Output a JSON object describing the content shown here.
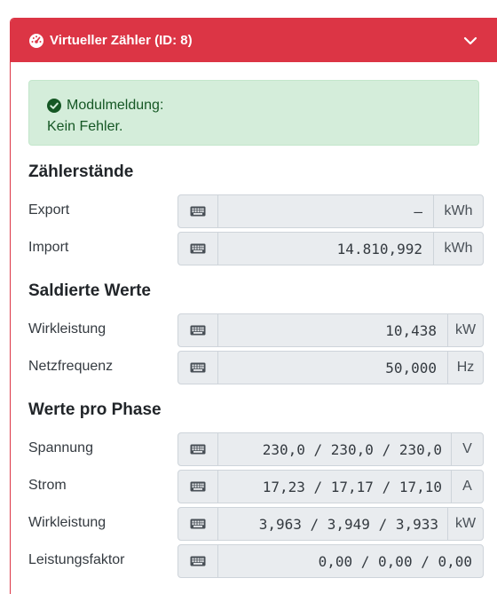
{
  "card": {
    "title": "Virtueller Zähler (ID: 8)",
    "color": "#dc3545"
  },
  "alert": {
    "line1": "Modulmeldung:",
    "line2": "Kein Fehler.",
    "color": "#d4edda"
  },
  "sections": {
    "meters": "Zählerstände",
    "balanced": "Saldierte Werte",
    "phase": "Werte pro Phase"
  },
  "rows": {
    "export": {
      "label": "Export",
      "value": "–",
      "unit": "kWh"
    },
    "import": {
      "label": "Import",
      "value": "14.810,992",
      "unit": "kWh"
    },
    "power": {
      "label": "Wirkleistung",
      "value": "10,438",
      "unit": "kW"
    },
    "frequency": {
      "label": "Netzfrequenz",
      "value": "50,000",
      "unit": "Hz"
    },
    "voltage": {
      "label": "Spannung",
      "value": "230,0 / 230,0 / 230,0",
      "unit": "V"
    },
    "current": {
      "label": "Strom",
      "value": "17,23 / 17,17 / 17,10",
      "unit": "A"
    },
    "phase_power": {
      "label": "Wirkleistung",
      "value": "3,963 / 3,949 / 3,933",
      "unit": "kW"
    },
    "power_factor": {
      "label": "Leistungsfaktor",
      "value": "0,00 / 0,00 / 0,00",
      "unit": ""
    }
  },
  "icons": {
    "header": "tachometer-icon",
    "collapse": "chevron-down-icon",
    "alert": "check-circle-icon",
    "input_addon": "keyboard-icon"
  }
}
